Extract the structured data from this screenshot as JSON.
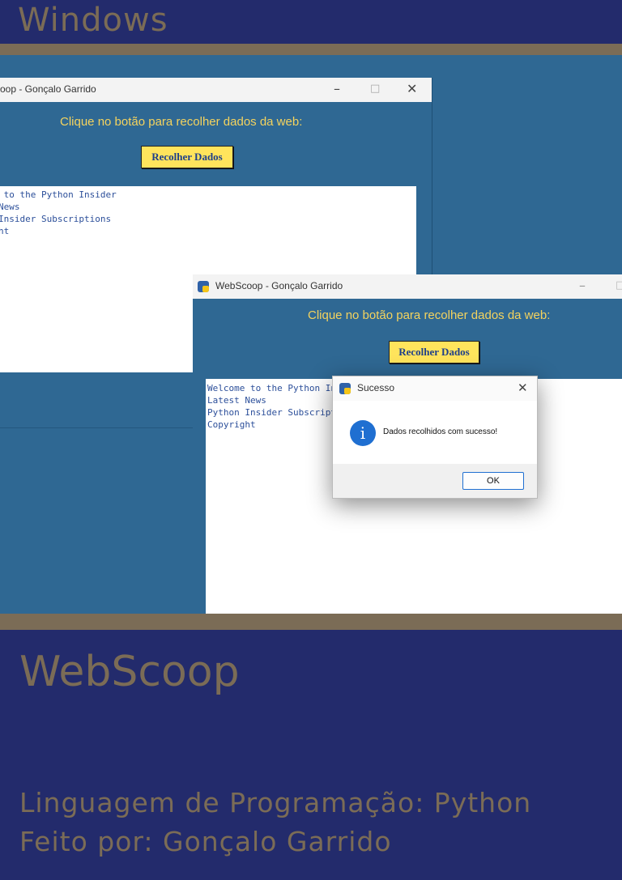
{
  "header": {
    "title": "Windows"
  },
  "window_back": {
    "title": "WebScoop - Gonçalo Garrido",
    "title_visible": "oop - Gonçalo Garrido",
    "prompt": "Clique no botão para recolher dados da web:",
    "button_label": "Recolher Dados",
    "lines_visible": [
      " to the Python Insider",
      "News",
      "Insider Subscriptions",
      "ht"
    ]
  },
  "window_front": {
    "title": "WebScoop - Gonçalo Garrido",
    "prompt": "Clique no botão para recolher dados da web:",
    "button_label": "Recolher Dados",
    "lines": [
      "Welcome to the Python Insider",
      "Latest News",
      "Python Insider Subscriptions",
      "Copyright"
    ]
  },
  "dialog": {
    "title": "Sucesso",
    "message": "Dados recolhidos com sucesso!",
    "ok_label": "OK",
    "icon": "info-icon"
  },
  "window_controls": {
    "minimize": "–",
    "maximize": "□",
    "close": "✕"
  },
  "footer": {
    "title": "WebScoop",
    "language_line": "Linguagem de Programação: Python",
    "author_line": "Feito por: Gonçalo Garrido"
  },
  "colors": {
    "navy": "#232b6c",
    "band": "#7b6c56",
    "desktop": "#2f6893",
    "prompt": "#f4d35e",
    "button": "#ffe45c"
  }
}
